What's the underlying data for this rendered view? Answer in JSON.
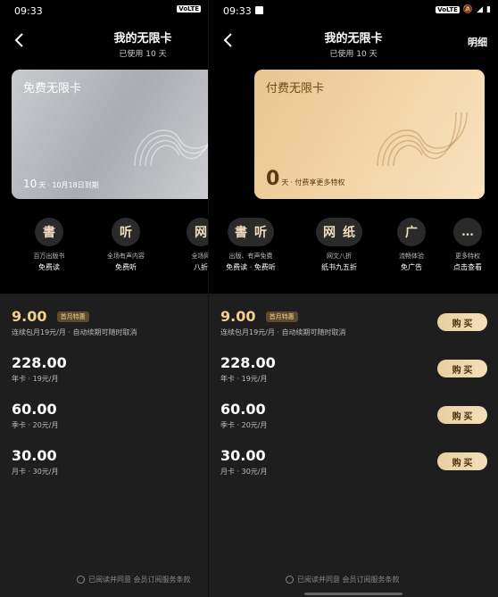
{
  "left": {
    "status_time": "09:33",
    "status_icons": "VoLTE",
    "title": "我的无限卡",
    "subtitle": "已使用 10 天",
    "card": {
      "name": "免费无限卡",
      "days": "10",
      "days_unit": "天",
      "expiry": "· 10月18日到期"
    },
    "benefits": [
      {
        "icon": "書",
        "line1": "百万出版书",
        "line2": "免费读"
      },
      {
        "icon": "听",
        "line1": "全场有声内容",
        "line2": "免费听"
      },
      {
        "icon": "网",
        "line1": "全场网",
        "line2": "八折"
      }
    ],
    "plans": [
      {
        "price": "9.00",
        "badge": "首月特惠",
        "desc": "连续包月19元/月 · 自动续期可随时取消"
      },
      {
        "price": "228.00",
        "desc": "年卡 · 19元/月"
      },
      {
        "price": "60.00",
        "desc": "季卡 · 20元/月"
      },
      {
        "price": "30.00",
        "desc": "月卡 · 30元/月"
      }
    ],
    "agreement": "已阅读并同意 会员订阅服务条款"
  },
  "right": {
    "status_time": "09:33",
    "status_icons": "VoLTE",
    "title": "我的无限卡",
    "subtitle": "已使用 10 天",
    "detail_label": "明细",
    "card": {
      "name": "付费无限卡",
      "days": "0",
      "days_unit": "天",
      "note": "· 付费享更多特权"
    },
    "benefits": [
      {
        "icon1": "書",
        "icon2": "听",
        "line1": "出版、有声免费",
        "line2": "免费读 · 免费听"
      },
      {
        "icon1": "网",
        "icon2": "纸",
        "line1": "网文八折",
        "line2": "纸书九五折"
      },
      {
        "icon1": "广",
        "line1": "流畅体验",
        "line2": "免广告"
      },
      {
        "icon1": "…",
        "line1": "更多特权",
        "line2": "点击查看"
      }
    ],
    "plans": [
      {
        "price": "9.00",
        "badge": "首月特惠",
        "desc": "连续包月19元/月 · 自动续期可随时取消",
        "button": "购 买"
      },
      {
        "price": "228.00",
        "desc": "年卡 · 19元/月",
        "button": "购 买"
      },
      {
        "price": "60.00",
        "desc": "季卡 · 20元/月",
        "button": "购 买"
      },
      {
        "price": "30.00",
        "desc": "月卡 · 30元/月",
        "button": "购 买"
      }
    ],
    "agreement": "已阅读并同意 会员订阅服务条款"
  },
  "colors": {
    "gold_accent": "#f2cf8b",
    "card_gold": "#f1d5a7",
    "card_silver": "#b9bcc0",
    "bottom_bg": "#1e1e1e"
  }
}
